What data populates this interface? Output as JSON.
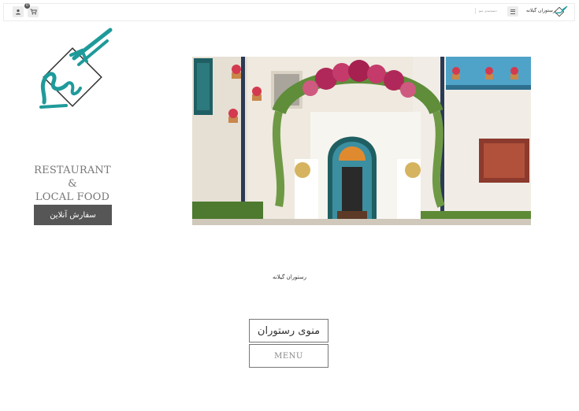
{
  "header": {
    "brand_name": "رستوران گیلانه",
    "nav_label": "دسته‌بندی منو",
    "cart_count": "0"
  },
  "icons": {
    "menu": "hamburger-icon",
    "cart": "cart-icon",
    "user": "user-icon",
    "logo": "gilaneh-logo-icon"
  },
  "hero": {
    "tagline_line1": "RESTAURANT",
    "tagline_line2": "&",
    "tagline_line3": "LOCAL FOOD",
    "order_button_label": "سفارش آنلاین"
  },
  "content": {
    "caption": "رستوران گیلانه",
    "menu_fa_label": "منوی رستوران",
    "menu_en_label": "MENU"
  },
  "colors": {
    "logo_teal": "#1f9a9a",
    "button_dark": "#565656"
  }
}
